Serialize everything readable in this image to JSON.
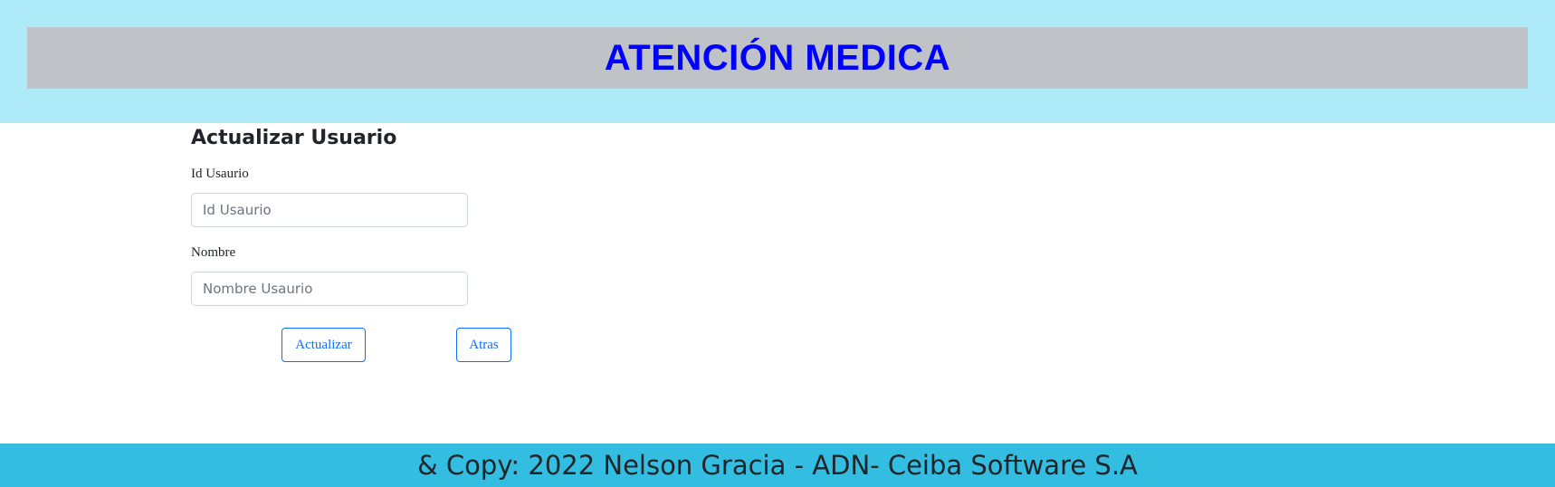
{
  "header": {
    "title": "ATENCIÓN MEDICA"
  },
  "form": {
    "title": "Actualizar Usuario",
    "fields": [
      {
        "label": "Id Usaurio",
        "placeholder": "Id Usaurio",
        "value": ""
      },
      {
        "label": "Nombre",
        "placeholder": "Nombre Usaurio",
        "value": ""
      }
    ],
    "buttons": {
      "update_label": "Actualizar",
      "back_label": "Atras"
    }
  },
  "footer": {
    "text": "& Copy: 2022 Nelson Gracia - ADN- Ceiba Software S.A"
  },
  "colors": {
    "header_background": "#aeeaf8",
    "header_bar": "#bfc3c8",
    "header_title": "#0000ff",
    "button_accent": "#0d6efd",
    "footer_background": "#33bde1"
  }
}
